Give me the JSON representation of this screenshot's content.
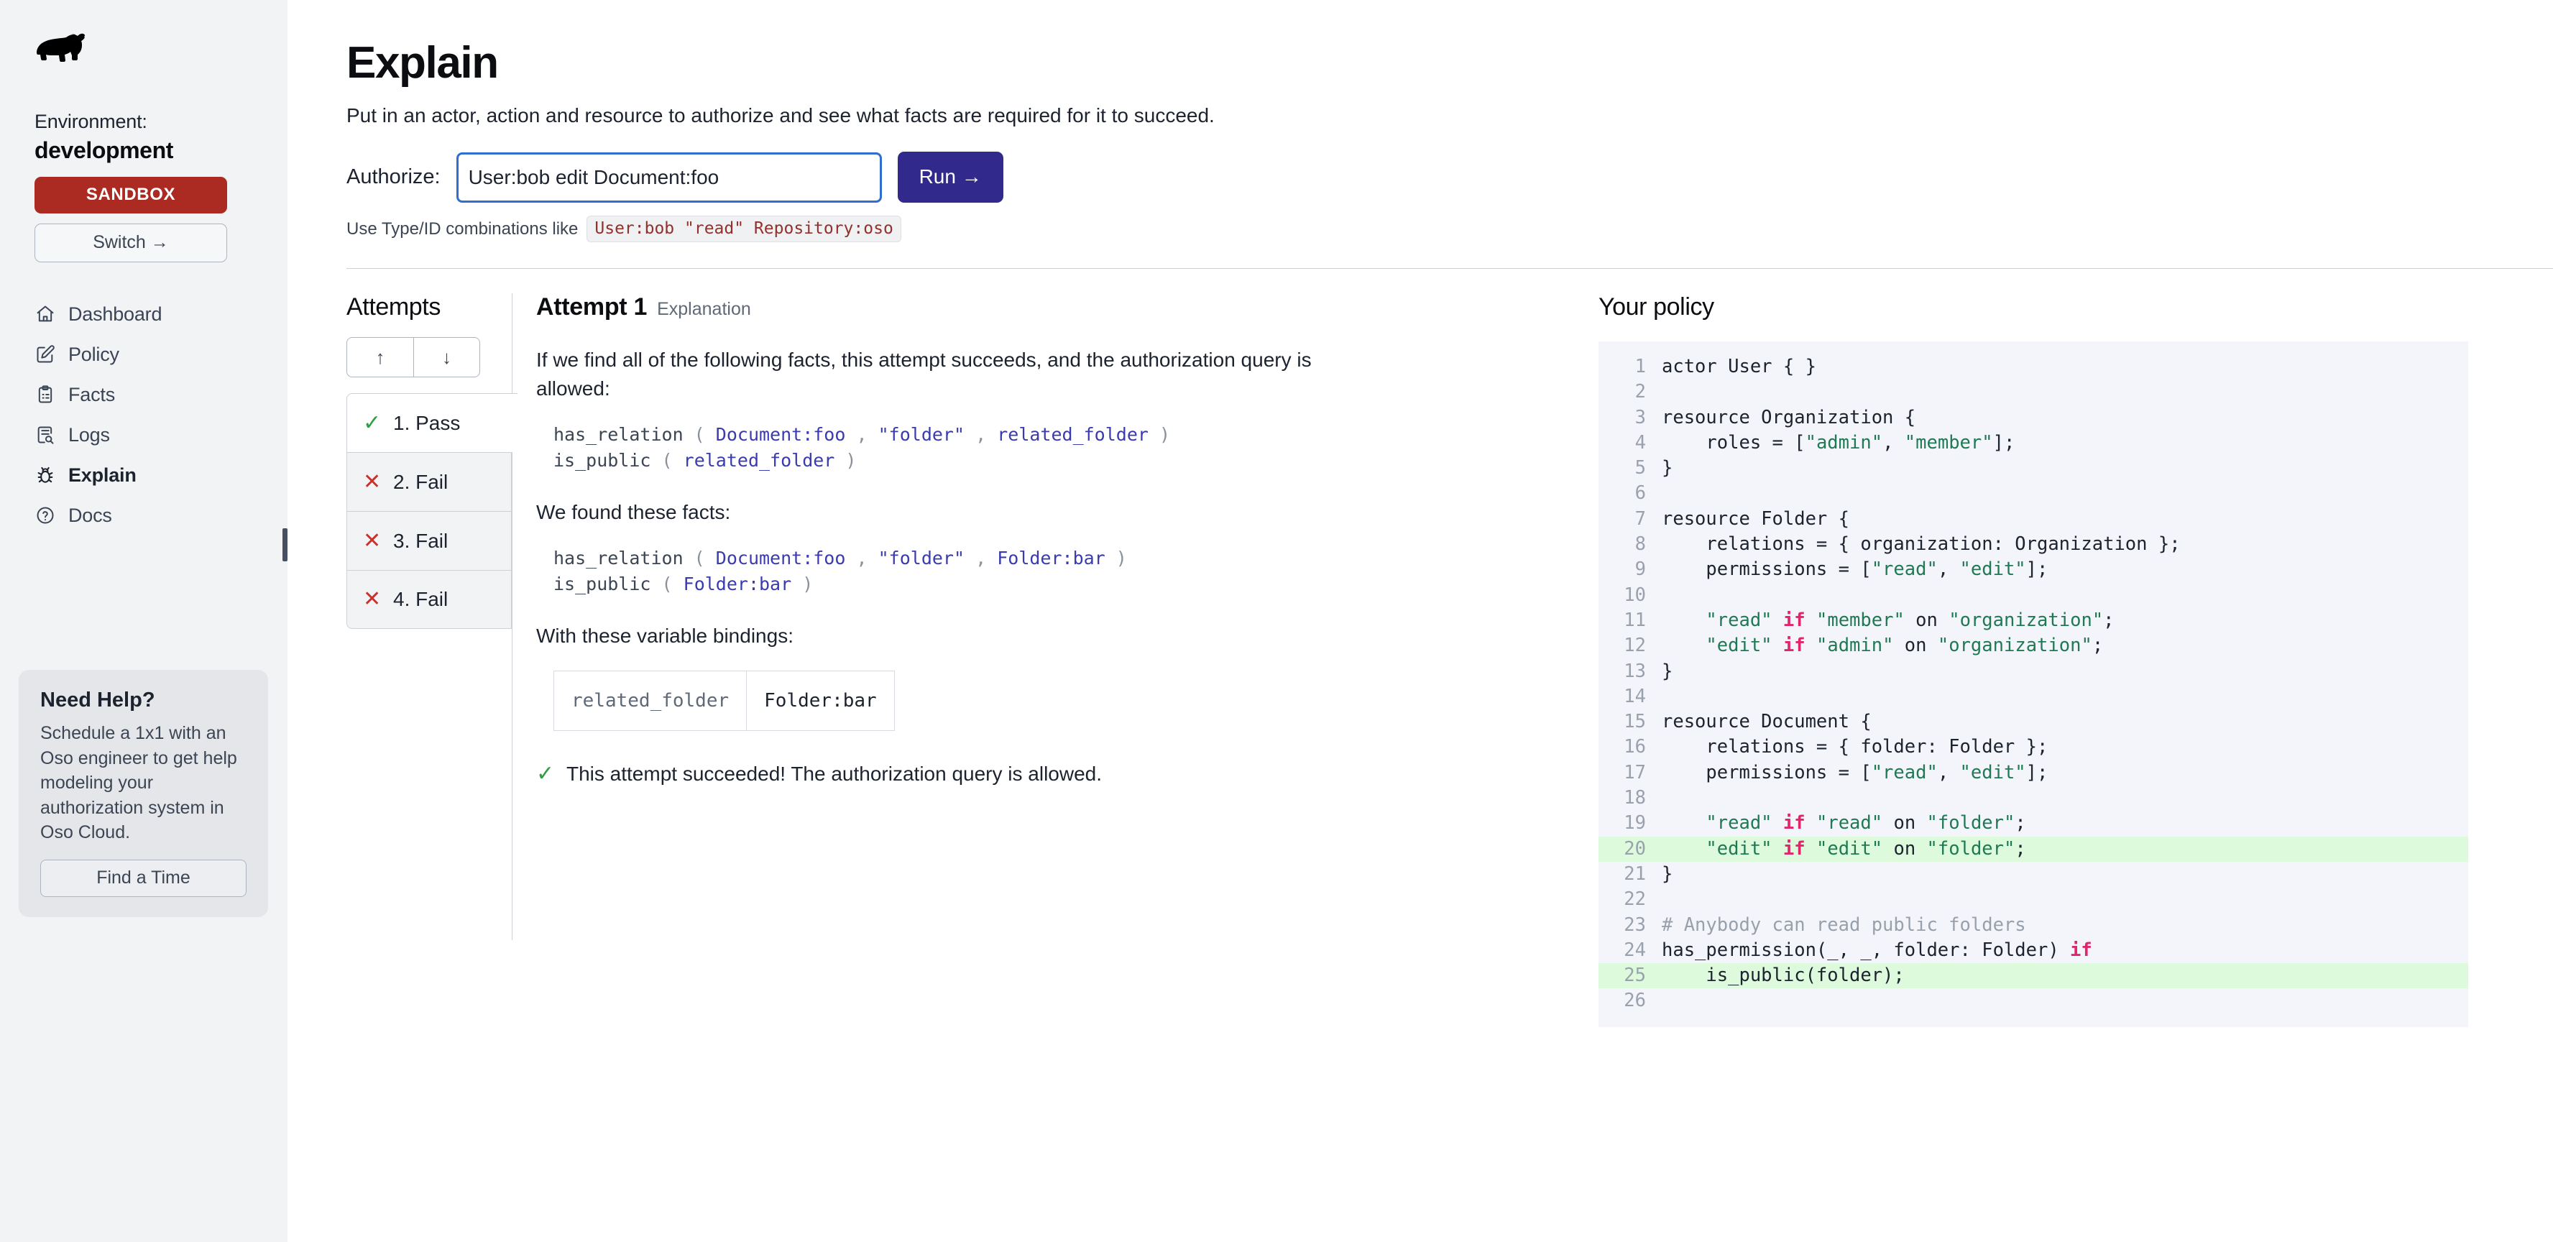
{
  "sidebar": {
    "logo_icon": "bear-logo",
    "environment_label": "Environment:",
    "environment_name": "development",
    "sandbox_badge": "SANDBOX",
    "switch_label": "Switch →",
    "nav": [
      {
        "label": "Dashboard",
        "icon": "home-icon"
      },
      {
        "label": "Policy",
        "icon": "pencil-square-icon"
      },
      {
        "label": "Facts",
        "icon": "clipboard-icon"
      },
      {
        "label": "Logs",
        "icon": "document-search-icon"
      },
      {
        "label": "Explain",
        "icon": "bug-icon"
      },
      {
        "label": "Docs",
        "icon": "question-circle-icon"
      }
    ],
    "help": {
      "title": "Need Help?",
      "text": "Schedule a 1x1 with an Oso engineer to get help modeling your authorization system in Oso Cloud.",
      "button": "Find a Time"
    }
  },
  "header": {
    "title": "Explain",
    "subtitle": "Put in an actor, action and resource to authorize and see what facts are required for it to succeed.",
    "authorize_label": "Authorize:",
    "authorize_value": "User:bob edit Document:foo",
    "authorize_placeholder": "User:bob \"read\" Repository:oso",
    "run_label": "Run →",
    "hint_prefix": "Use Type/ID combinations like",
    "hint_code": "User:bob \"read\" Repository:oso"
  },
  "attempts": {
    "heading": "Attempts",
    "sort_up": "↑",
    "sort_down": "↓",
    "items": [
      {
        "mark": "✓",
        "label": "1. Pass",
        "status": "pass",
        "selected": true
      },
      {
        "mark": "✕",
        "label": "2. Fail",
        "status": "fail",
        "selected": false
      },
      {
        "mark": "✕",
        "label": "3. Fail",
        "status": "fail",
        "selected": false
      },
      {
        "mark": "✕",
        "label": "4. Fail",
        "status": "fail",
        "selected": false
      }
    ]
  },
  "explanation": {
    "title": "Attempt 1",
    "kicker": "Explanation",
    "intro": "If we find all of the following facts, this attempt succeeds, and the authorization query is allowed:",
    "required_facts": [
      "has_relation ( Document:foo , \"folder\" , related_folder )",
      "is_public ( related_folder )"
    ],
    "found_label": "We found these facts:",
    "found_facts": [
      "has_relation ( Document:foo , \"folder\" , Folder:bar )",
      "is_public ( Folder:bar )"
    ],
    "bindings_label": "With these variable bindings:",
    "bindings": [
      {
        "variable": "related_folder",
        "value": "Folder:bar"
      }
    ],
    "result_mark": "✓",
    "result_text": "This attempt succeeded! The authorization query is allowed."
  },
  "policy": {
    "heading": "Your policy",
    "lines": [
      {
        "n": "1",
        "text": "actor User { }",
        "hl": false
      },
      {
        "n": "2",
        "text": "",
        "hl": false
      },
      {
        "n": "3",
        "text": "resource Organization {",
        "hl": false
      },
      {
        "n": "4",
        "text": "    roles = [\"admin\", \"member\"];",
        "hl": false
      },
      {
        "n": "5",
        "text": "}",
        "hl": false
      },
      {
        "n": "6",
        "text": "",
        "hl": false
      },
      {
        "n": "7",
        "text": "resource Folder {",
        "hl": false
      },
      {
        "n": "8",
        "text": "    relations = { organization: Organization };",
        "hl": false
      },
      {
        "n": "9",
        "text": "    permissions = [\"read\", \"edit\"];",
        "hl": false
      },
      {
        "n": "10",
        "text": "",
        "hl": false
      },
      {
        "n": "11",
        "text": "    \"read\" if \"member\" on \"organization\";",
        "hl": false
      },
      {
        "n": "12",
        "text": "    \"edit\" if \"admin\" on \"organization\";",
        "hl": false
      },
      {
        "n": "13",
        "text": "}",
        "hl": false
      },
      {
        "n": "14",
        "text": "",
        "hl": false
      },
      {
        "n": "15",
        "text": "resource Document {",
        "hl": false
      },
      {
        "n": "16",
        "text": "    relations = { folder: Folder };",
        "hl": false
      },
      {
        "n": "17",
        "text": "    permissions = [\"read\", \"edit\"];",
        "hl": false
      },
      {
        "n": "18",
        "text": "",
        "hl": false
      },
      {
        "n": "19",
        "text": "    \"read\" if \"read\" on \"folder\";",
        "hl": false
      },
      {
        "n": "20",
        "text": "    \"edit\" if \"edit\" on \"folder\";",
        "hl": true
      },
      {
        "n": "21",
        "text": "}",
        "hl": false
      },
      {
        "n": "22",
        "text": "",
        "hl": false
      },
      {
        "n": "23",
        "text": "# Anybody can read public folders",
        "hl": false
      },
      {
        "n": "24",
        "text": "has_permission(_, _, folder: Folder) if",
        "hl": false
      },
      {
        "n": "25",
        "text": "    is_public(folder);",
        "hl": true
      },
      {
        "n": "26",
        "text": "",
        "hl": false
      }
    ]
  },
  "colors": {
    "accent": "#312a8c",
    "sandbox": "#ab2a22",
    "pass": "#2f9e44",
    "fail": "#c9322c",
    "highlight": "#ddfadd",
    "focus_ring": "#2f6fd0"
  }
}
